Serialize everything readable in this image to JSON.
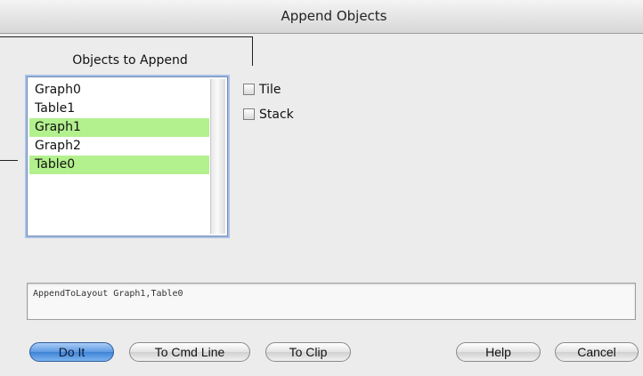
{
  "window": {
    "title": "Append Objects"
  },
  "objects_group": {
    "title": "Objects to Append",
    "items": [
      {
        "label": "Graph0",
        "selected": false
      },
      {
        "label": "Table1",
        "selected": false
      },
      {
        "label": "Graph1",
        "selected": true
      },
      {
        "label": "Graph2",
        "selected": false
      },
      {
        "label": "Table0",
        "selected": true
      }
    ]
  },
  "options": {
    "tile_label": "Tile",
    "tile_checked": false,
    "stack_label": "Stack",
    "stack_checked": false
  },
  "command_text": "AppendToLayout Graph1,Table0",
  "buttons": {
    "do_it": "Do It",
    "to_cmd_line": "To Cmd Line",
    "to_clip": "To Clip",
    "help": "Help",
    "cancel": "Cancel"
  },
  "colors": {
    "selection": "#b3f08e",
    "default_button": "#5e9ae3",
    "list_focus_ring": "#a9c1e6"
  }
}
